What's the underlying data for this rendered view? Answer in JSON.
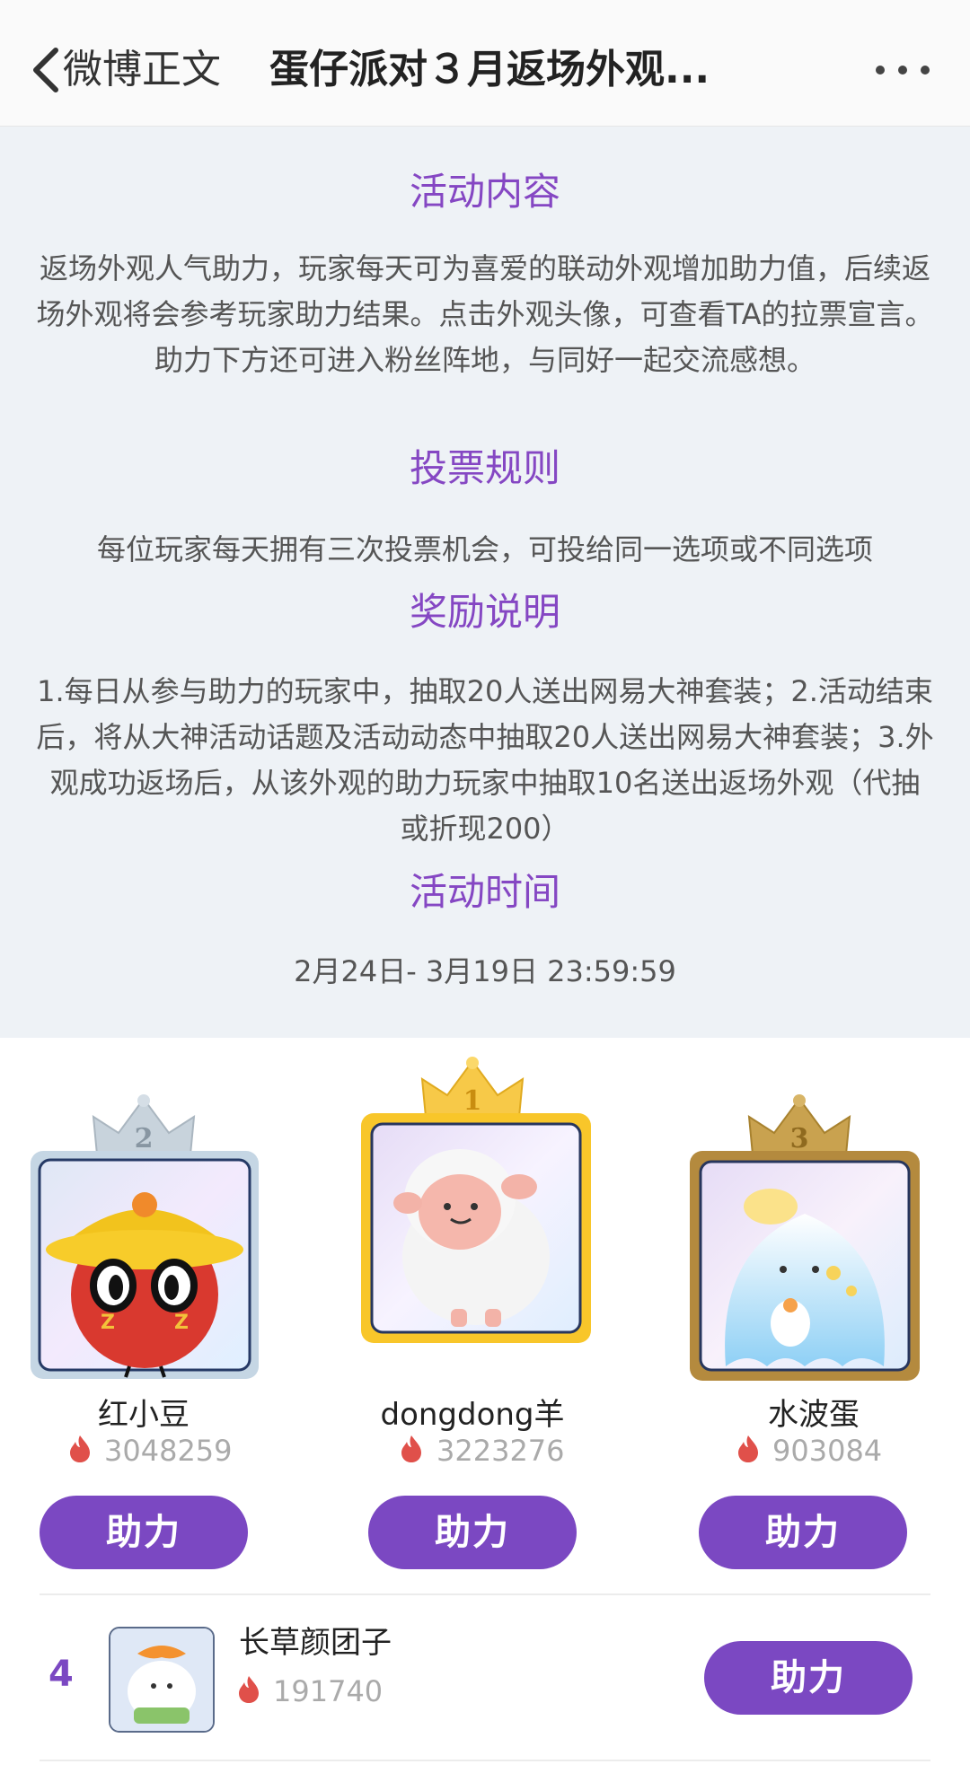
{
  "header": {
    "back_label": "微博正文",
    "title": "蛋仔派对３月返场外观..."
  },
  "info": {
    "content_title": "活动内容",
    "content_text": "返场外观人气助力，玩家每天可为喜爱的联动外观增加助力值，后续返场外观将会参考玩家助力结果。点击外观头像，可查看TA的拉票宣言。助力下方还可进入粉丝阵地，与同好一起交流感想。",
    "rules_title": "投票规则",
    "rules_text": "每位玩家每天拥有三次投票机会，可投给同一选项或不同选项",
    "reward_title": "奖励说明",
    "reward_text": "1.每日从参与助力的玩家中，抽取20人送出网易大神套装；2.活动结束后，将从大神活动话题及活动动态中抽取20人送出网易大神套装；3.外观成功返场后，从该外观的助力玩家中抽取10名送出返场外观（代抽或折现200）",
    "time_title": "活动时间",
    "time_text": "2月24日- 3月19日 23:59:59"
  },
  "podium": [
    {
      "rank": "2",
      "name": "红小豆",
      "score": "3048259",
      "button": "助力"
    },
    {
      "rank": "1",
      "name": "dongdong羊",
      "score": "3223276",
      "button": "助力"
    },
    {
      "rank": "3",
      "name": "水波蛋",
      "score": "903084",
      "button": "助力"
    }
  ],
  "list": [
    {
      "rank": "4",
      "name": "长草颜团子",
      "score": "191740",
      "button": "助力"
    }
  ],
  "colors": {
    "accent": "#7b48c2",
    "title_purple": "#8547c3",
    "fire": "#e0504a",
    "gold": "#f7c948",
    "silver": "#c8d3dc",
    "bronze": "#c9a24f"
  }
}
